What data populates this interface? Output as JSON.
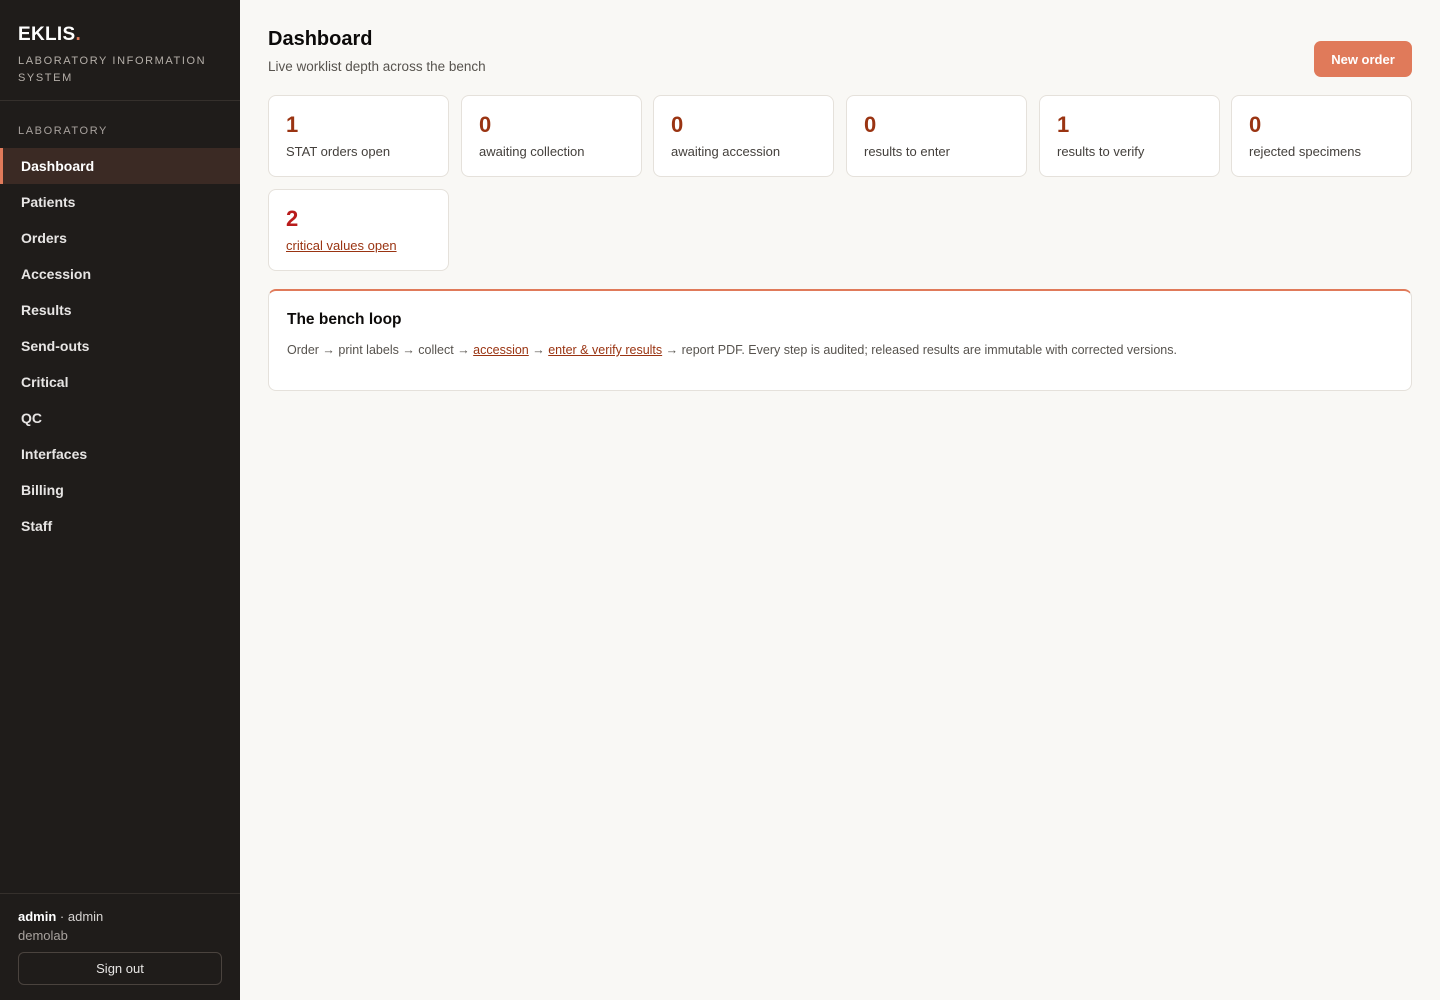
{
  "brand": {
    "name": "EKLIS",
    "dot": ".",
    "subtitle": "LABORATORY INFORMATION SYSTEM"
  },
  "sidebar": {
    "section": "LABORATORY",
    "items": [
      {
        "label": "Dashboard",
        "active": true
      },
      {
        "label": "Patients"
      },
      {
        "label": "Orders"
      },
      {
        "label": "Accession"
      },
      {
        "label": "Results"
      },
      {
        "label": "Send-outs"
      },
      {
        "label": "Critical"
      },
      {
        "label": "QC"
      },
      {
        "label": "Interfaces"
      },
      {
        "label": "Billing"
      },
      {
        "label": "Staff"
      }
    ]
  },
  "user": {
    "name": "admin",
    "separator": " · ",
    "role": "admin",
    "org": "demolab",
    "signout_label": "Sign out"
  },
  "header": {
    "title": "Dashboard",
    "subtitle": "Live worklist depth across the bench",
    "new_order_label": "New order"
  },
  "stats": [
    {
      "value": "1",
      "label": "STAT orders open"
    },
    {
      "value": "0",
      "label": "awaiting collection"
    },
    {
      "value": "0",
      "label": "awaiting accession"
    },
    {
      "value": "0",
      "label": "results to enter"
    },
    {
      "value": "1",
      "label": "results to verify"
    },
    {
      "value": "0",
      "label": "rejected specimens"
    },
    {
      "value": "2",
      "label": "critical values open"
    }
  ],
  "panel": {
    "title": "The bench loop",
    "text_before": "Order → print labels → collect → ",
    "link1": "accession",
    "arrow": " → ",
    "link2": "enter & verify results",
    "text_after": " → report PDF. Every step is audited; released results are immutable with corrected versions."
  },
  "colors": {
    "accent": "#e07a5a",
    "sidebar_bg": "#1f1c1a",
    "stat_value": "#9a3412",
    "critical_value": "#b91c1c"
  }
}
